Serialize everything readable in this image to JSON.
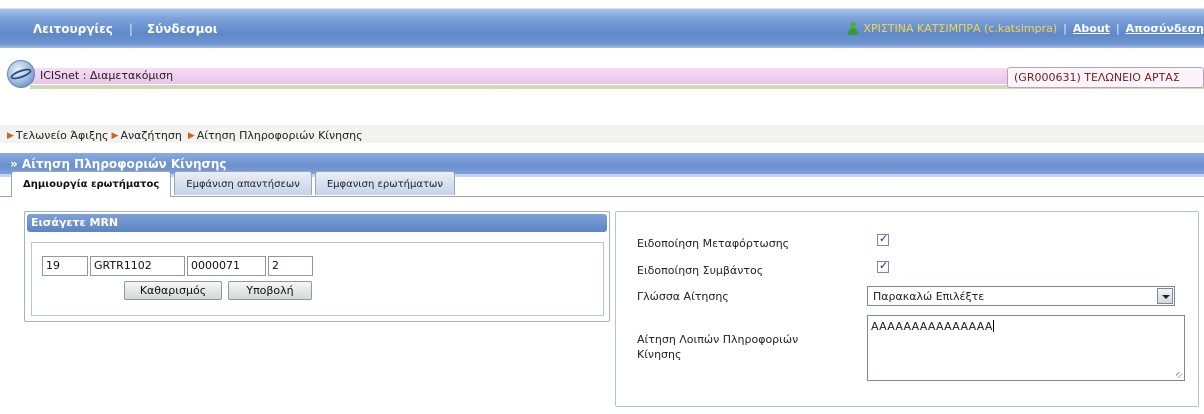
{
  "topbar": {
    "nav": [
      "Λειτουργίες",
      "Σύνδεσμοι"
    ],
    "user": "ΧΡΙΣΤΙΝΑ ΚΑΤΣΙΜΠΡΑ (c.katsimpra)",
    "about": "About",
    "logout": "Αποσύνδεση"
  },
  "app": {
    "title": "ICISnet : Διαμετακόμιση",
    "customs_office": "(GR000631) ΤΕΛΩΝΕΙΟ ΑΡΤΑΣ"
  },
  "breadcrumb": [
    "Τελωνείο Άφιξης",
    "Αναζήτηση",
    "Αίτηση Πληροφοριών Κίνησης"
  ],
  "section_title": "» Αίτηση Πληροφοριών Κίνησης",
  "tabs": [
    "Δημιουργία ερωτήματος",
    "Εμφάνιση απαντήσεων",
    "Εμφανιση ερωτήματων"
  ],
  "mrn": {
    "header": "Εισάγετε MRN",
    "fields": [
      "19",
      "GRTR1102",
      "0000071",
      "2"
    ],
    "clear_button": "Καθαρισμός",
    "submit_button": "Υποβολή"
  },
  "form": {
    "transfer_label": "Ειδοποίηση Μεταφόρτωσης",
    "transfer_checked": true,
    "incident_label": "Ειδοποίηση Συμβάντος",
    "incident_checked": true,
    "language_label": "Γλώσσα Αίτησης",
    "language_value": "Παρακαλώ Επιλέξτε",
    "other_info_label": "Αίτηση Λοιπών Πληροφοριών Κίνησης",
    "other_info_value": "AAAAAAAAAAAAAAA"
  }
}
